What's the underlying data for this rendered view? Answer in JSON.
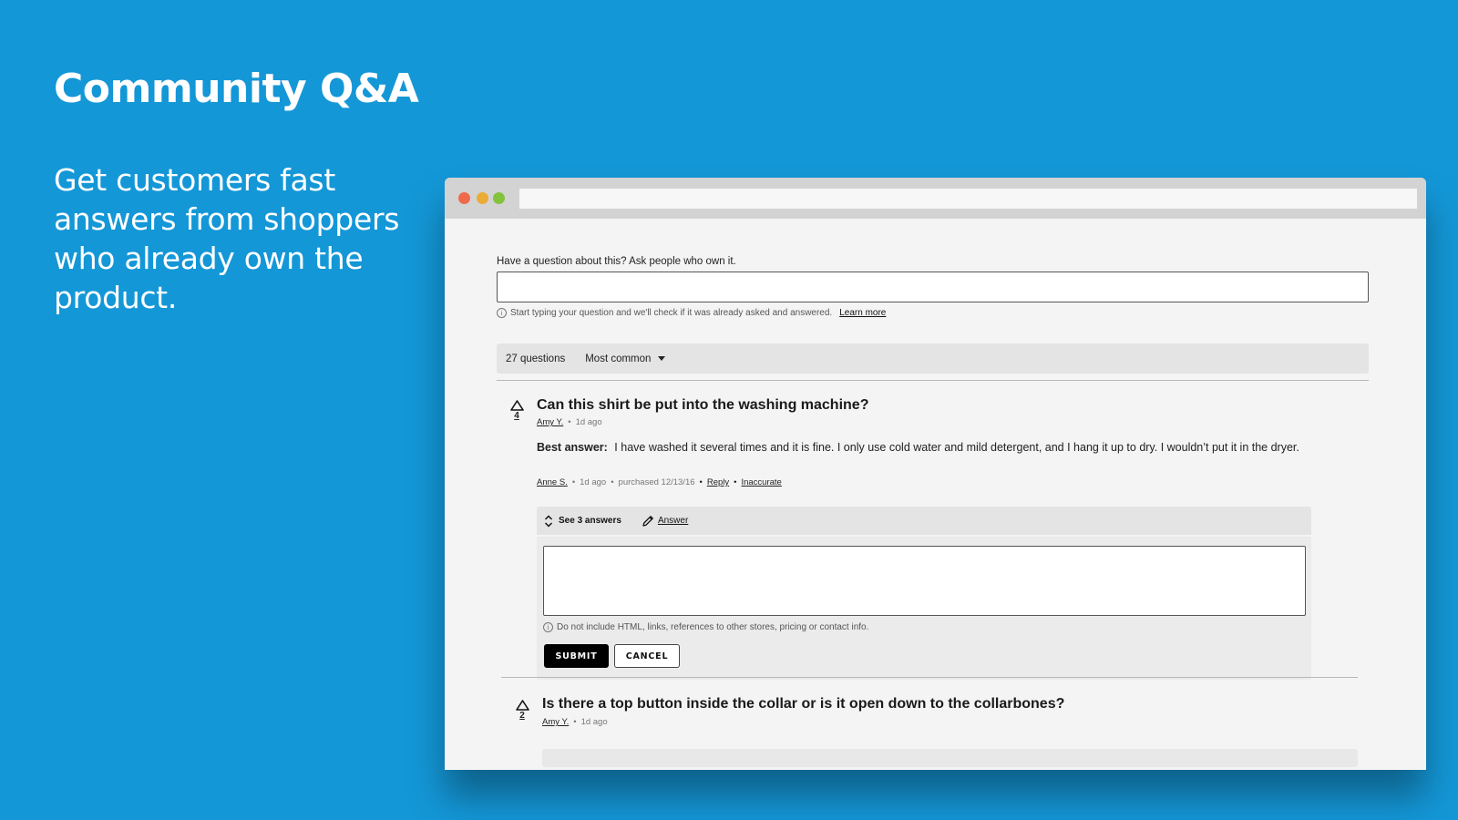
{
  "hero": {
    "title": "Community Q&A",
    "subtitle": "Get customers fast answers from shoppers who already own the product."
  },
  "colors": {
    "background": "#1497d7",
    "window_bg": "#f4f4f4",
    "titlebar": "#d3d3d3",
    "traffic_red": "#ef6a4b",
    "traffic_yellow": "#ebac36",
    "traffic_green": "#85c23c",
    "submit_bg": "#000000"
  },
  "ask": {
    "label": "Have a question about this? Ask people who own it.",
    "input_value": "",
    "hint": "Start typing your question and we'll check if it was already asked and answered.",
    "learn_more": "Learn more"
  },
  "toolbar": {
    "count": "27 questions",
    "sort": "Most common"
  },
  "questions": [
    {
      "votes": "4",
      "title": "Can this shirt be put into the washing machine?",
      "author": "Amy Y.",
      "time": "1d ago",
      "best_answer": {
        "label": "Best answer:",
        "text": "I have washed it several times and it is fine. I only use cold water and mild detergent, and I hang it up to dry. I wouldn’t put it in the dryer.",
        "author": "Anne S.",
        "time": "1d ago",
        "purchased": "purchased 12/13/16",
        "reply": "Reply",
        "inaccurate": "Inaccurate"
      },
      "answers_panel": {
        "see_answers": "See 3 answers",
        "answer_link": "Answer",
        "textarea_value": "",
        "hint": "Do not include HTML, links, references to other stores, pricing or contact info.",
        "submit": "SUBMIT",
        "cancel": "CANCEL"
      }
    },
    {
      "votes": "2",
      "title": "Is there a top button inside the collar or is it open down to the collarbones?",
      "author": "Amy Y.",
      "time": "1d ago"
    }
  ],
  "separator": "•"
}
